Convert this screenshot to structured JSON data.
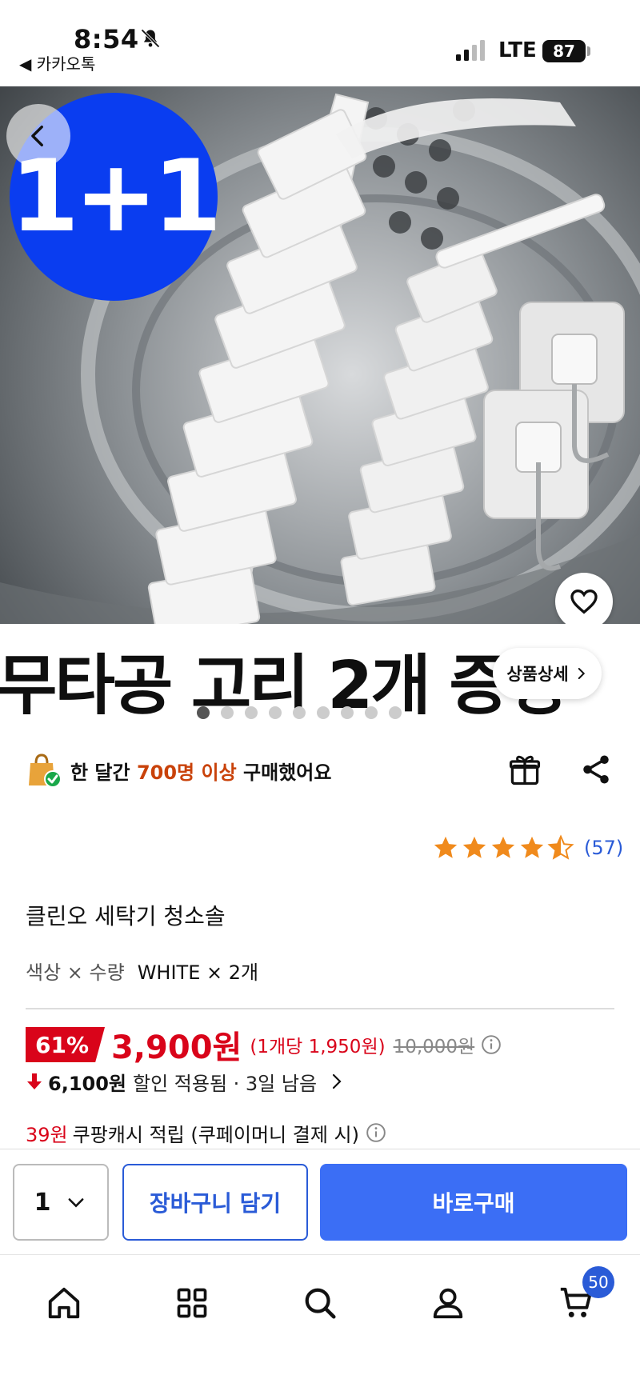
{
  "status_bar": {
    "time": "8:54",
    "back_app": "◀ 카카오톡",
    "network": "LTE",
    "battery": "87"
  },
  "hero": {
    "badge": "1+1",
    "caption": "무타공 고리 2개 증정",
    "detail_button": "상품상세",
    "image_count": 10,
    "current_image": 1
  },
  "purchase_info": {
    "prefix": "한 달간 ",
    "highlight": "700명 이상",
    "suffix": " 구매했어요"
  },
  "rating": {
    "stars": 4.5,
    "count": "(57)"
  },
  "product": {
    "name": "클린오 세탁기 청소솔",
    "option_label": "색상 × 수량",
    "option_value": "WHITE × 2개"
  },
  "price": {
    "discount": "61%",
    "price": "3,900원",
    "unit_price": "(1개당 1,950원)",
    "original": "10,000원",
    "saved_amount": "6,100원",
    "saved_text": "할인 적용됨 · 3일 남음"
  },
  "cash": {
    "amount": "39원",
    "text": "쿠팡캐시 적립 (쿠페이머니 결제 시)"
  },
  "buy_bar": {
    "quantity": "1",
    "cart_button": "장바구니 담기",
    "buy_button": "바로구매"
  },
  "nav": {
    "cart_badge": "50"
  },
  "colors": {
    "accent_blue": "#3b6ef5",
    "price_red": "#d9041a",
    "badge_blue": "#0a3df0"
  }
}
